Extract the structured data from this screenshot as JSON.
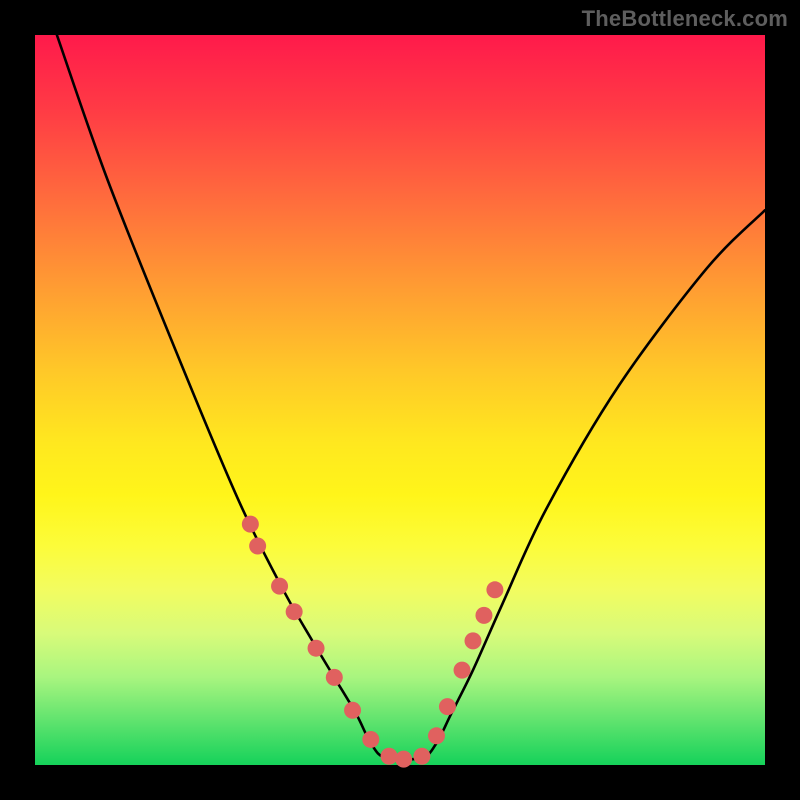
{
  "watermark": "TheBottleneck.com",
  "chart_data": {
    "type": "line",
    "title": "",
    "xlabel": "",
    "ylabel": "",
    "xlim": [
      0,
      100
    ],
    "ylim": [
      0,
      100
    ],
    "grid": false,
    "legend": false,
    "series": [
      {
        "name": "curve",
        "x": [
          3,
          10,
          20,
          28,
          34,
          38,
          41,
          44,
          46,
          48,
          53,
          55,
          57,
          60,
          64,
          70,
          80,
          92,
          100
        ],
        "y": [
          100,
          80,
          55,
          36,
          24,
          17,
          12,
          7,
          3,
          1,
          1,
          3,
          7,
          13,
          22,
          35,
          52,
          68,
          76
        ]
      }
    ],
    "markers": {
      "name": "dots",
      "color": "#e0615f",
      "x": [
        29.5,
        30.5,
        33.5,
        35.5,
        38.5,
        41.0,
        43.5,
        46.0,
        48.5,
        50.5,
        53.0,
        55.0,
        56.5,
        58.5,
        60.0,
        61.5,
        63.0
      ],
      "y": [
        33.0,
        30.0,
        24.5,
        21.0,
        16.0,
        12.0,
        7.5,
        3.5,
        1.2,
        0.8,
        1.2,
        4.0,
        8.0,
        13.0,
        17.0,
        20.5,
        24.0
      ]
    }
  }
}
